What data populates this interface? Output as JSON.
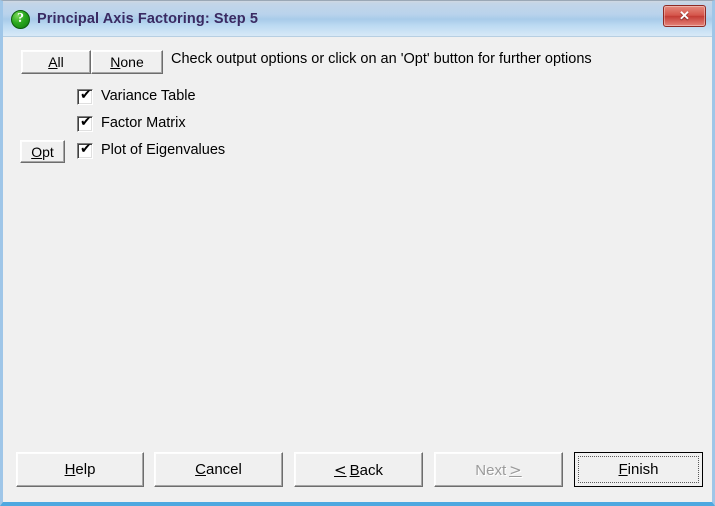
{
  "window": {
    "title": "Principal Axis Factoring: Step 5",
    "title_icon": "green-question-help-icon",
    "close_label": "✕",
    "accent_border_color": "#4ea8e0",
    "title_text_color": "#3a2a62",
    "close_button_color": "#c33a33",
    "body_background": "#f0f0f0"
  },
  "toolbar": {
    "all_label": "All",
    "all_accel": "A",
    "none_label": "None",
    "none_accel": "N",
    "instruction": "Check output options or click on an 'Opt' button for further options"
  },
  "options": {
    "opt_button_label": "Opt",
    "opt_button_accel": "O",
    "check_glyph": "✔",
    "items": [
      {
        "label": "Variance Table",
        "checked": true,
        "has_opt": false
      },
      {
        "label": "Factor Matrix",
        "checked": true,
        "has_opt": false
      },
      {
        "label": "Plot of Eigenvalues",
        "checked": true,
        "has_opt": true
      }
    ]
  },
  "footer": {
    "help_label": "Help",
    "help_accel": "H",
    "cancel_label": "Cancel",
    "cancel_accel": "C",
    "back_label": "Back",
    "back_accel": "B",
    "back_arrow": "<",
    "next_label": "Next",
    "next_accel": "N",
    "next_arrow": ">",
    "next_enabled": false,
    "finish_label": "Finish",
    "finish_accel": "F",
    "finish_focused": true
  }
}
